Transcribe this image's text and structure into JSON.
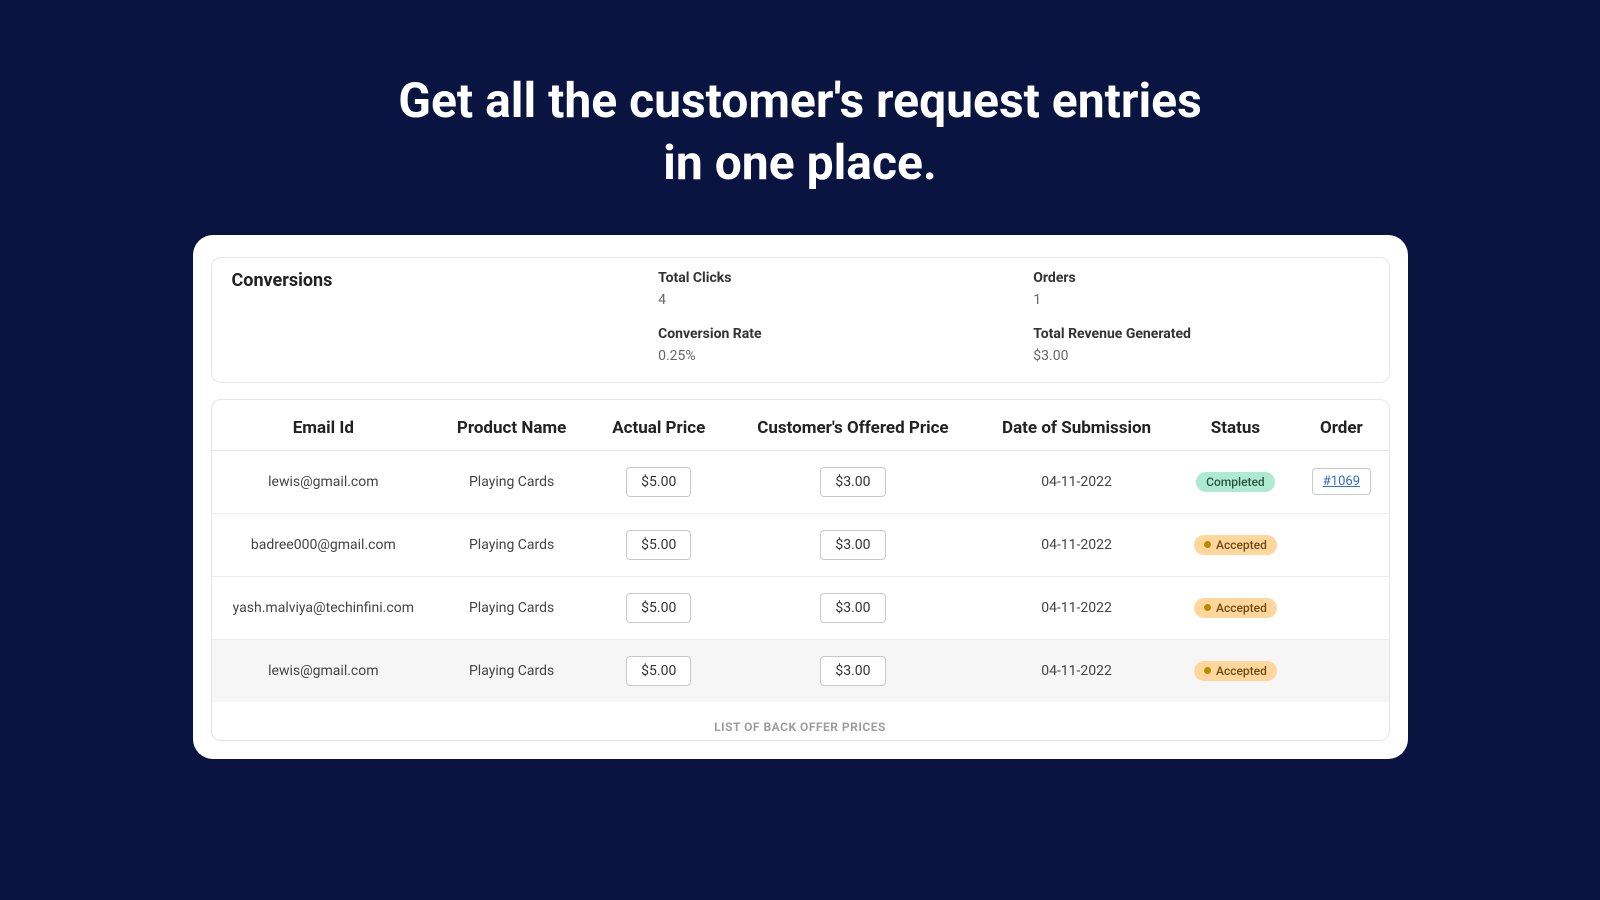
{
  "hero": {
    "line1": "Get all the customer's request entries",
    "line2": "in one place."
  },
  "stats": {
    "title": "Conversions",
    "items": [
      {
        "label": "Total Clicks",
        "value": "4"
      },
      {
        "label": "Orders",
        "value": "1"
      },
      {
        "label": "Conversion Rate",
        "value": "0.25%"
      },
      {
        "label": "Total Revenue Generated",
        "value": "$3.00"
      }
    ]
  },
  "table": {
    "headers": {
      "email": "Email Id",
      "product": "Product Name",
      "actual": "Actual Price",
      "offered": "Customer's Offered Price",
      "date": "Date of Submission",
      "status": "Status",
      "order": "Order"
    },
    "rows": [
      {
        "email": "lewis@gmail.com",
        "product": "Playing Cards",
        "actual": "$5.00",
        "offered": "$3.00",
        "date": "04-11-2022",
        "status_type": "completed",
        "status_text": "Completed",
        "order": "#1069"
      },
      {
        "email": "badree000@gmail.com",
        "product": "Playing Cards",
        "actual": "$5.00",
        "offered": "$3.00",
        "date": "04-11-2022",
        "status_type": "accepted",
        "status_text": "Accepted",
        "order": ""
      },
      {
        "email": "yash.malviya@techinfini.com",
        "product": "Playing Cards",
        "actual": "$5.00",
        "offered": "$3.00",
        "date": "04-11-2022",
        "status_type": "accepted",
        "status_text": "Accepted",
        "order": ""
      },
      {
        "email": "lewis@gmail.com",
        "product": "Playing Cards",
        "actual": "$5.00",
        "offered": "$3.00",
        "date": "04-11-2022",
        "status_type": "accepted",
        "status_text": "Accepted",
        "order": ""
      }
    ]
  },
  "footer": {
    "caption": "LIST OF BACK OFFER PRICES"
  }
}
